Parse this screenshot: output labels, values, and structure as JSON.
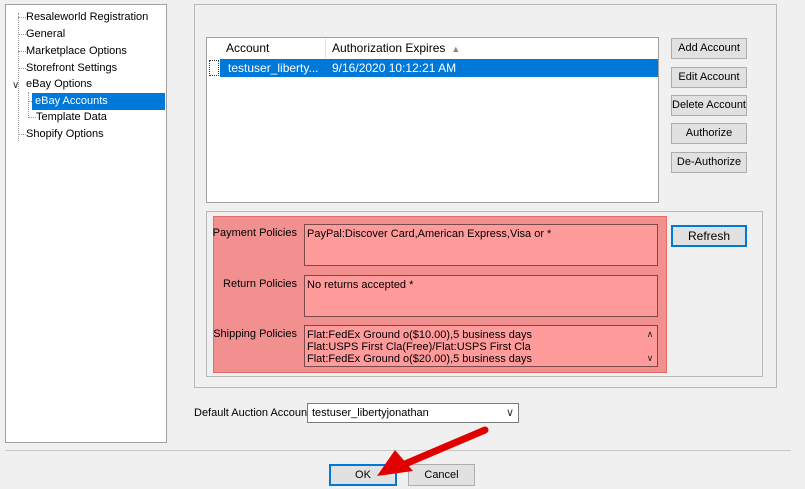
{
  "tree": {
    "items": [
      {
        "label": "Resaleworld Registration"
      },
      {
        "label": "General"
      },
      {
        "label": "Marketplace Options"
      },
      {
        "label": "Storefront Settings"
      },
      {
        "label": "eBay Options"
      },
      {
        "label": "eBay Accounts"
      },
      {
        "label": "Template Data"
      },
      {
        "label": "Shopify Options"
      }
    ],
    "selected": "eBay Accounts"
  },
  "accounts": {
    "columns": [
      "Account",
      "Authorization Expires"
    ],
    "rows": [
      {
        "account": "testuser_liberty...",
        "expires": "9/16/2020 10:12:21 AM"
      }
    ]
  },
  "actions": {
    "add": "Add Account",
    "edit": "Edit Account",
    "delete": "Delete Account",
    "authorize": "Authorize",
    "deauthorize": "De-Authorize",
    "refresh": "Refresh"
  },
  "policies": {
    "payment_label": "Payment Policies",
    "payment_value": "PayPal:Discover Card,American Express,Visa or *",
    "return_label": "Return Policies",
    "return_value": "No returns accepted *",
    "shipping_label": "Shipping Policies",
    "shipping_lines": [
      "Flat:FedEx Ground o($10.00),5 business days",
      "Flat:USPS First Cla(Free)/Flat:USPS First Cla",
      "Flat:FedEx Ground o($20.00),5 business days"
    ]
  },
  "auction": {
    "label": "Default Auction Account",
    "value": "testuser_libertyjonathan"
  },
  "footer": {
    "ok": "OK",
    "cancel": "Cancel"
  },
  "colors": {
    "selection": "#0078d7",
    "policies_highlight": "#f29090",
    "arrow": "#e00000"
  }
}
